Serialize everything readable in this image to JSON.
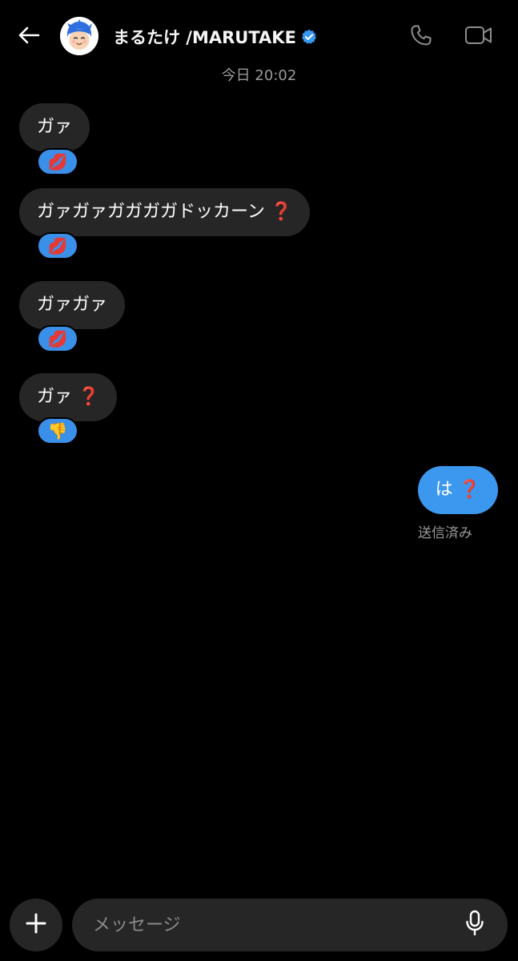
{
  "header": {
    "contact_name": "まるたけ /MARUTAKE",
    "verified": true,
    "icons": {
      "back": "arrow-left-icon",
      "call": "phone-icon",
      "video": "video-camera-icon",
      "verified": "verified-badge-icon"
    }
  },
  "thread": {
    "timestamp": "今日 20:02",
    "incoming": [
      {
        "text": "ガァ",
        "question_mark": "",
        "reaction": "💋"
      },
      {
        "text": "ガァガァガガガガドッカーン",
        "question_mark": "❓",
        "reaction": "💋"
      },
      {
        "text": "ガァガァ",
        "question_mark": "",
        "reaction": "💋"
      },
      {
        "text": "ガァ",
        "question_mark": "❓",
        "reaction": "👎"
      }
    ],
    "outgoing": [
      {
        "text": "は",
        "question_mark": "❓",
        "status": "送信済み"
      }
    ]
  },
  "composer": {
    "placeholder": "メッセージ",
    "value": "",
    "icons": {
      "add": "plus-icon",
      "mic": "microphone-icon"
    }
  },
  "colors": {
    "background": "#000000",
    "incoming_bubble": "#262626",
    "outgoing_bubble": "#3c97ee",
    "reaction_pill": "#3a8fe8",
    "secondary_text": "#9a9a9a",
    "verified_blue": "#3897f0"
  }
}
